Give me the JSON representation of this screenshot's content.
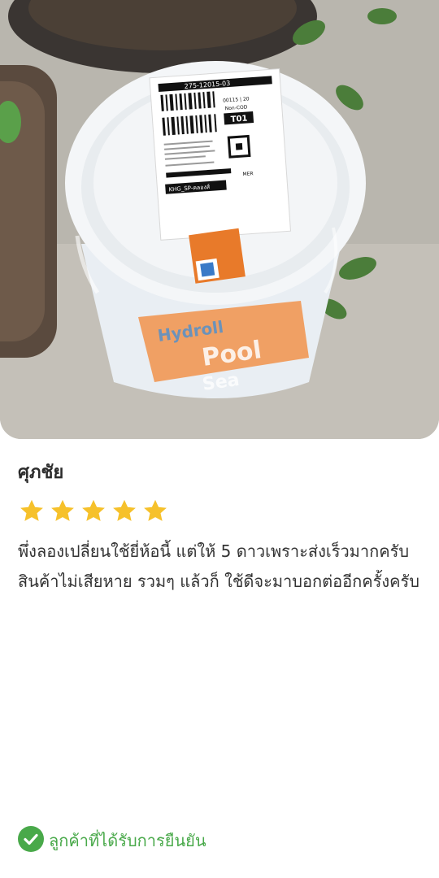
{
  "photo": {
    "label_top_code": "275-12015-03",
    "label_code_right": "00115 | 20",
    "label_cod": "Non-COD",
    "label_sort": "T01",
    "label_route": "KHG_SP-คลองส์",
    "label_mer": "MER",
    "bucket_text_1": "Hydroll",
    "bucket_text_2": "Pool",
    "bucket_text_3": "Sea"
  },
  "review": {
    "reviewer_name": "ศุภชัย",
    "rating": 5,
    "rating_max": 5,
    "star_color": "#f6c12b",
    "text": "พึ่งลองเปลี่ยนใช้ยี่ห้อนี้ แต่ให้ 5 ดาวเพราะส่งเร็วมากครับ สินค้าไม่เสียหาย รวมๆ แล้วก็ ใช้ดีจะมาบอกต่ออีกครั้งครับ"
  },
  "verified": {
    "label": "ลูกค้าที่ได้รับการยืนยัน",
    "color": "#49a94a",
    "icon": "check-circle-icon"
  }
}
